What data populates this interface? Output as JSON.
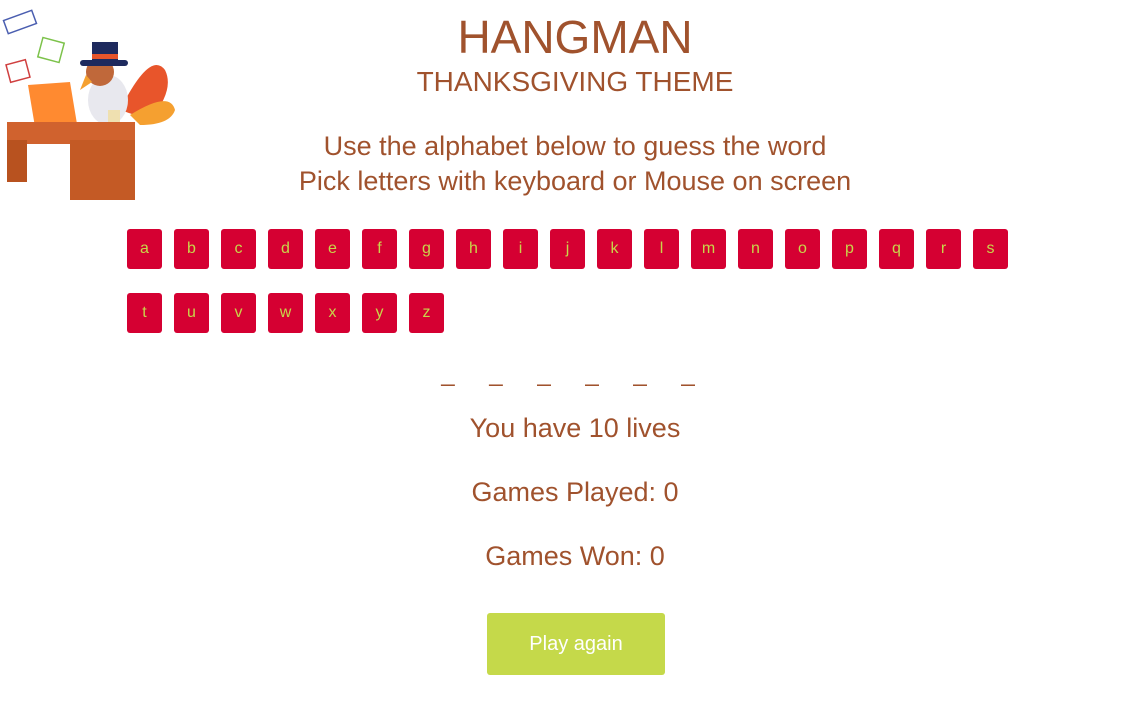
{
  "header": {
    "title": "HANGMAN",
    "subtitle": "THANKSGIVING THEME"
  },
  "instructions": [
    "Use the alphabet below to guess the word",
    "Pick letters with keyboard or Mouse on screen"
  ],
  "letters": [
    "a",
    "b",
    "c",
    "d",
    "e",
    "f",
    "g",
    "h",
    "i",
    "j",
    "k",
    "l",
    "m",
    "n",
    "o",
    "p",
    "q",
    "r",
    "s",
    "t",
    "u",
    "v",
    "w",
    "x",
    "y",
    "z"
  ],
  "word_blanks": "_ _ _ _ _ _",
  "status": {
    "lives": "You have 10 lives",
    "games_played": "Games Played: 0",
    "games_won": "Games Won: 0"
  },
  "play_again_label": "Play again",
  "colors": {
    "text": "#a0522d",
    "key_bg": "#d50032",
    "key_text": "#c8d64a",
    "button": "#c5d94a"
  }
}
